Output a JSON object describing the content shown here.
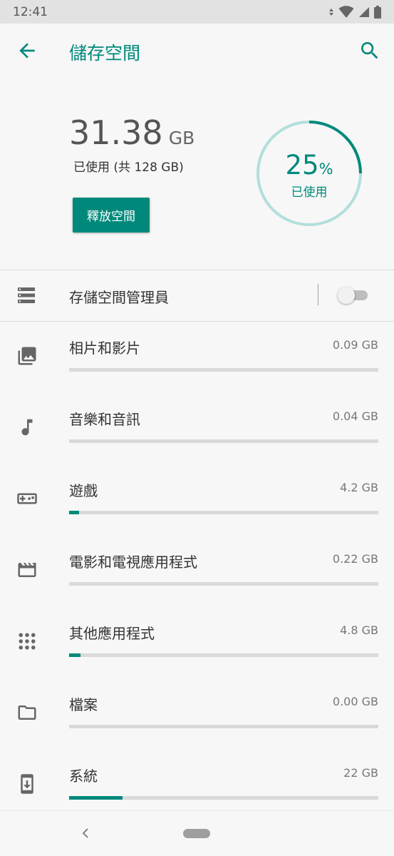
{
  "status_bar": {
    "time": "12:41"
  },
  "app_bar": {
    "title": "儲存空間"
  },
  "summary": {
    "used_value": "31.38",
    "used_unit": "GB",
    "used_desc": "已使用 (共 128 GB)",
    "free_button": "釋放空間",
    "percent": "25",
    "percent_symbol": "%",
    "percent_label": "已使用",
    "percent_fraction": 0.25
  },
  "manager": {
    "label": "存儲空間管理員",
    "enabled": false
  },
  "categories": [
    {
      "label": "相片和影片",
      "size": "0.09 GB",
      "icon": "photo-library-icon",
      "fraction": 0.0
    },
    {
      "label": "音樂和音訊",
      "size": "0.04 GB",
      "icon": "music-note-icon",
      "fraction": 0.0
    },
    {
      "label": "遊戲",
      "size": "4.2 GB",
      "icon": "gamepad-icon",
      "fraction": 0.033
    },
    {
      "label": "電影和電視應用程式",
      "size": "0.22 GB",
      "icon": "movie-icon",
      "fraction": 0.0
    },
    {
      "label": "其他應用程式",
      "size": "4.8 GB",
      "icon": "apps-icon",
      "fraction": 0.038
    },
    {
      "label": "檔案",
      "size": "0.00 GB",
      "icon": "folder-icon",
      "fraction": 0.0
    },
    {
      "label": "系統",
      "size": "22 GB",
      "icon": "system-update-icon",
      "fraction": 0.172
    }
  ],
  "colors": {
    "accent": "#00897b",
    "ring_track": "#b2dfdb",
    "bar_track": "#d9d9d9"
  }
}
